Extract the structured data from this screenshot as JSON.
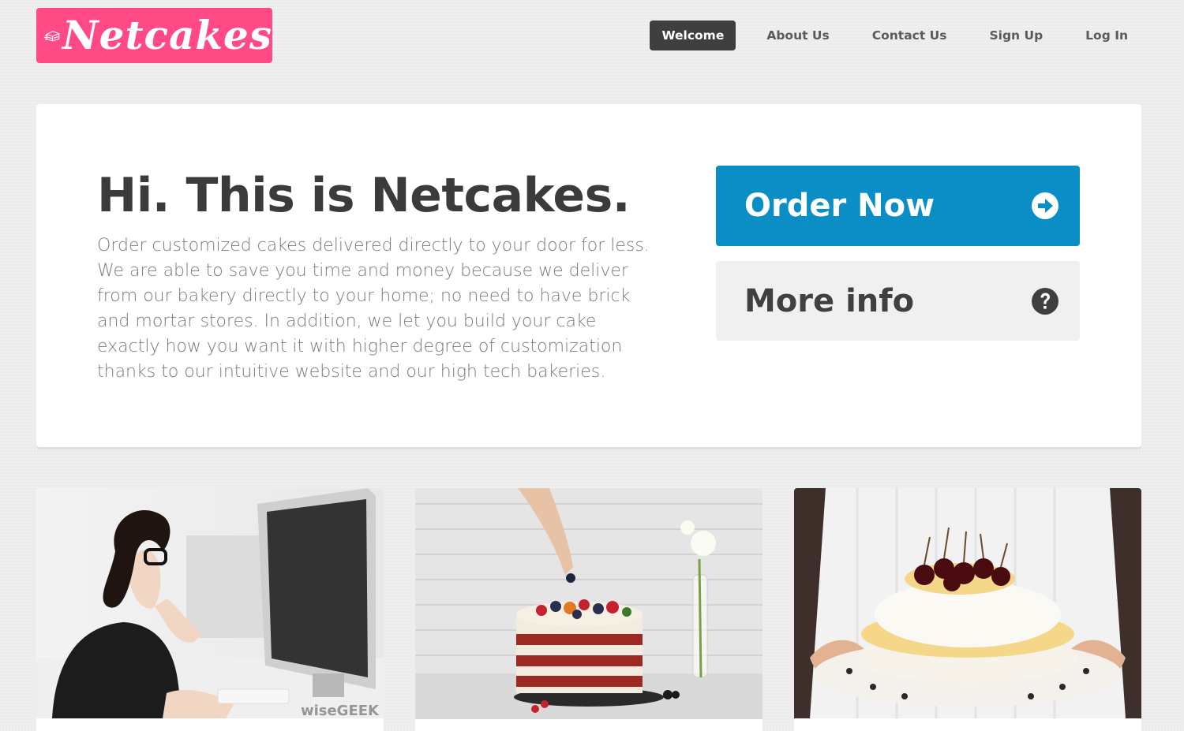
{
  "brand": {
    "name": "Netcakes",
    "color": "#ff4a86",
    "icon": "cake-icon"
  },
  "nav": {
    "items": [
      {
        "label": "Welcome",
        "active": true
      },
      {
        "label": "About Us",
        "active": false
      },
      {
        "label": "Contact Us",
        "active": false
      },
      {
        "label": "Sign Up",
        "active": false
      },
      {
        "label": "Log In",
        "active": false
      }
    ]
  },
  "hero": {
    "title": "Hi. This is Netcakes.",
    "description": "Order customized cakes delivered directly to your door for less. We are able to save you time and money because we deliver from our bakery directly to your home; no need to have brick and mortar stores. In addition, we let you build your cake exactly how you want it with higher degree of customization thanks to our intuitive website and our high tech bakeries.",
    "order_button": {
      "label": "Order Now",
      "icon": "arrow-circle-right-icon",
      "color": "#0a8ec5"
    },
    "info_button": {
      "label": "More info",
      "icon": "question-circle-icon"
    }
  },
  "cards": [
    {
      "image": "woman-at-computer-photo",
      "watermark": "wiseGEEK"
    },
    {
      "image": "berry-cake-photo"
    },
    {
      "image": "cherry-pavlova-photo"
    }
  ]
}
